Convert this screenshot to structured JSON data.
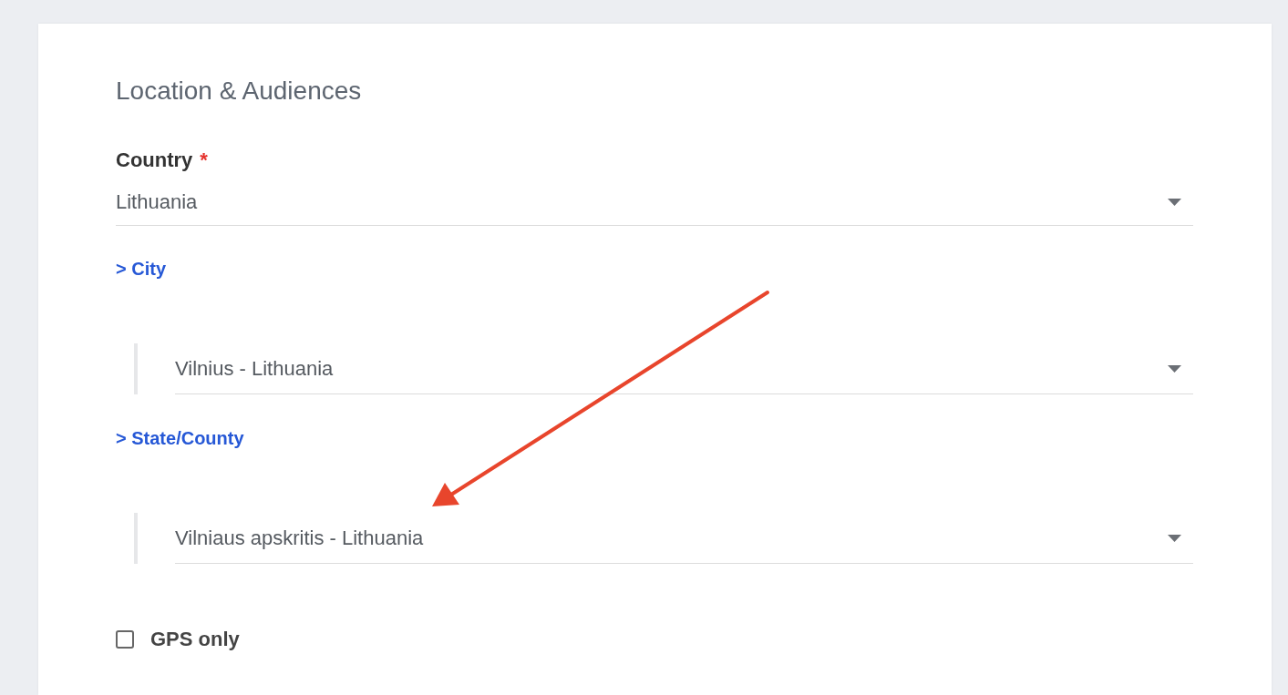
{
  "section": {
    "title": "Location & Audiences"
  },
  "country": {
    "label": "Country",
    "required_mark": "*",
    "value": "Lithuania"
  },
  "groups": [
    {
      "toggle": "> City",
      "value": "Vilnius - Lithuania"
    },
    {
      "toggle": "> State/County",
      "value": "Vilniaus apskritis - Lithuania"
    }
  ],
  "gps_only": {
    "label": "GPS only",
    "checked": false
  }
}
